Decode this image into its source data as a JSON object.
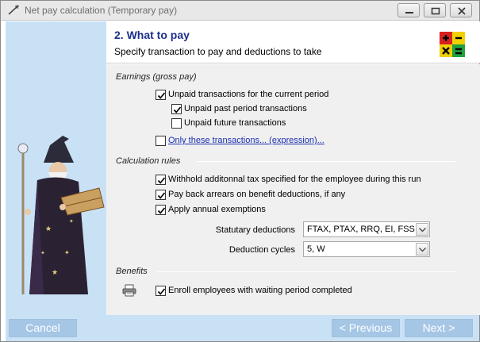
{
  "window": {
    "title": "Net pay calculation (Temporary pay)"
  },
  "header": {
    "step_title": "2. What to pay",
    "step_subtitle": "Specify transaction to pay and deductions to take",
    "icon": "math-operators-icon"
  },
  "earnings": {
    "heading": "Earnings (gross pay)",
    "unpaid_current": {
      "label": "Unpaid transactions for the current period",
      "checked": true
    },
    "unpaid_past": {
      "label": "Unpaid past period transactions",
      "checked": true
    },
    "unpaid_future": {
      "label": "Unpaid future transactions",
      "checked": false
    },
    "only_these": {
      "label": "Only these transactions... (expression)...",
      "checked": false
    }
  },
  "calculation": {
    "heading": "Calculation rules",
    "withhold": {
      "label": "Withhold additonnal tax specified for the employee during this run",
      "checked": true
    },
    "payback": {
      "label": "Pay back arrears on benefit deductions, if any",
      "checked": true
    },
    "exemptions": {
      "label": "Apply annual exemptions",
      "checked": true
    },
    "statutory_label": "Statutary deductions",
    "statutory_value": "FTAX, PTAX, RRQ, EI, FSS, F",
    "cycles_label": "Deduction cycles",
    "cycles_value": "5, W"
  },
  "benefits": {
    "heading": "Benefits",
    "enroll": {
      "label": "Enroll employees with waiting period completed",
      "checked": true
    }
  },
  "footer": {
    "cancel_label": "Cancel",
    "previous_label": "< Previous",
    "next_label": "Next >"
  },
  "colors": {
    "accent_title": "#1c2f8a",
    "side_panel": "#c9e1f4",
    "disabled_button": "#a6c6e6",
    "link": "#1a2fb0"
  }
}
